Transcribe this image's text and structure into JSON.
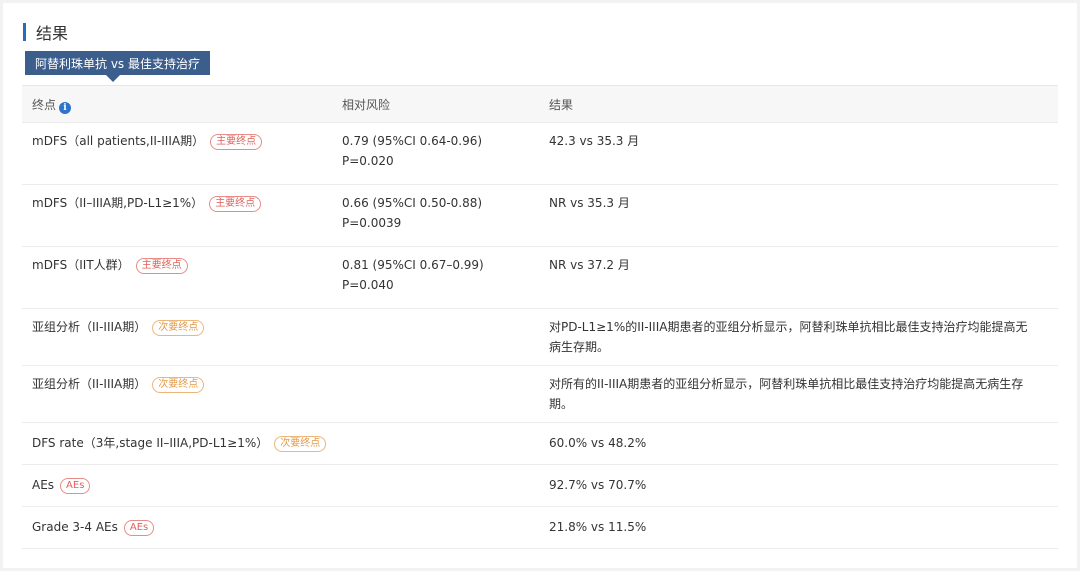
{
  "section": {
    "title": "结果"
  },
  "tab": {
    "label": "阿替利珠单抗 vs 最佳支持治疗"
  },
  "table": {
    "headers": {
      "endpoint": "终点",
      "relative_risk": "相对风险",
      "result": "结果"
    },
    "info_icon": "info-icon",
    "rows": [
      {
        "endpoint": "mDFS（all patients,II-IIIA期）",
        "tag": "主要终点",
        "tag_type": "primary",
        "rr_line1": "0.79 (95%CI 0.64-0.96)",
        "rr_line2": "P=0.020",
        "result": "42.3 vs 35.3 月"
      },
      {
        "endpoint": "mDFS（II–IIIA期,PD-L1≥1%）",
        "tag": "主要终点",
        "tag_type": "primary",
        "rr_line1": "0.66 (95%CI 0.50-0.88)",
        "rr_line2": "P=0.0039",
        "result": "NR vs 35.3 月"
      },
      {
        "endpoint": "mDFS（IIT人群）",
        "tag": "主要终点",
        "tag_type": "primary",
        "rr_line1": "0.81 (95%CI 0.67–0.99)",
        "rr_line2": "P=0.040",
        "result": "NR vs 37.2 月"
      },
      {
        "endpoint": "亚组分析（II-IIIA期）",
        "tag": "次要终点",
        "tag_type": "secondary",
        "rr_line1": "",
        "rr_line2": "",
        "result_line1": "对PD-L1≥1%的II-IIIA期患者的亚组分析显示，阿替利珠单抗相比最佳支持治疗均能提高无",
        "result_line2": "病生存期。"
      },
      {
        "endpoint": "亚组分析（II-IIIA期）",
        "tag": "次要终点",
        "tag_type": "secondary",
        "rr_line1": "",
        "rr_line2": "",
        "result_line1": "对所有的II-IIIA期患者的亚组分析显示，阿替利珠单抗相比最佳支持治疗均能提高无病生存",
        "result_line2": "期。"
      },
      {
        "endpoint": "DFS rate（3年,stage II–IIIA,PD-L1≥1%）",
        "tag": "次要终点",
        "tag_type": "secondary",
        "result": "60.0% vs 48.2%"
      },
      {
        "endpoint": "AEs",
        "tag": "AEs",
        "tag_type": "ae",
        "result": "92.7% vs 70.7%"
      },
      {
        "endpoint": "Grade 3-4 AEs",
        "tag": "AEs",
        "tag_type": "ae",
        "result": "21.8% vs 11.5%"
      }
    ]
  }
}
